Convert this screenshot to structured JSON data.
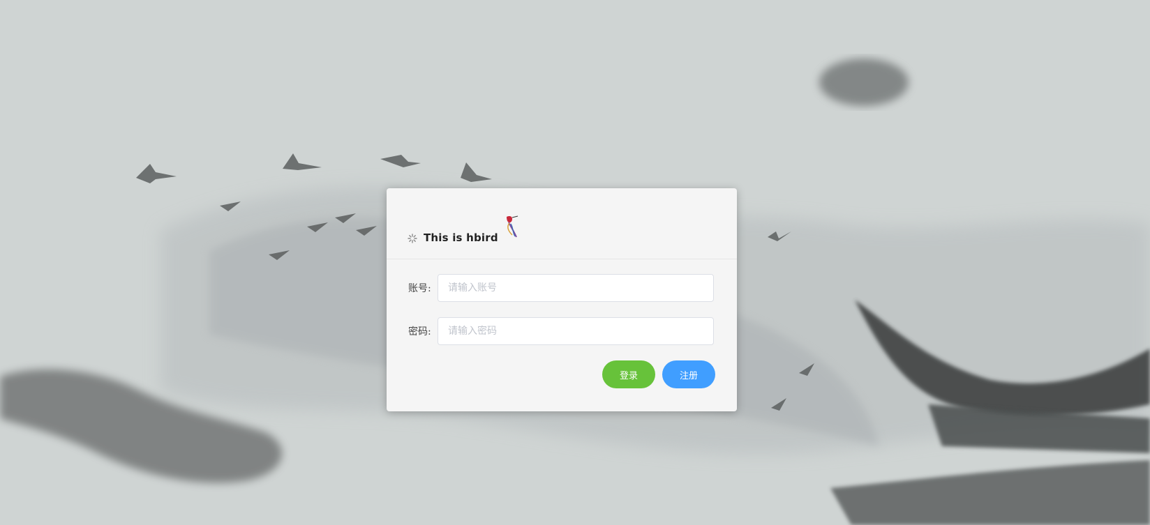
{
  "card": {
    "title": "This is hbird"
  },
  "form": {
    "account": {
      "label": "账号:",
      "placeholder": "请输入账号",
      "value": ""
    },
    "password": {
      "label": "密码:",
      "placeholder": "请输入密码",
      "value": ""
    }
  },
  "buttons": {
    "login_label": "登录",
    "register_label": "注册"
  },
  "colors": {
    "background": "#cfd4d3",
    "card": "#f5f5f5",
    "login_button": "#67c23a",
    "register_button": "#409eff"
  },
  "icons": {
    "header_left": "loading-icon",
    "logo": "hummingbird-logo"
  }
}
